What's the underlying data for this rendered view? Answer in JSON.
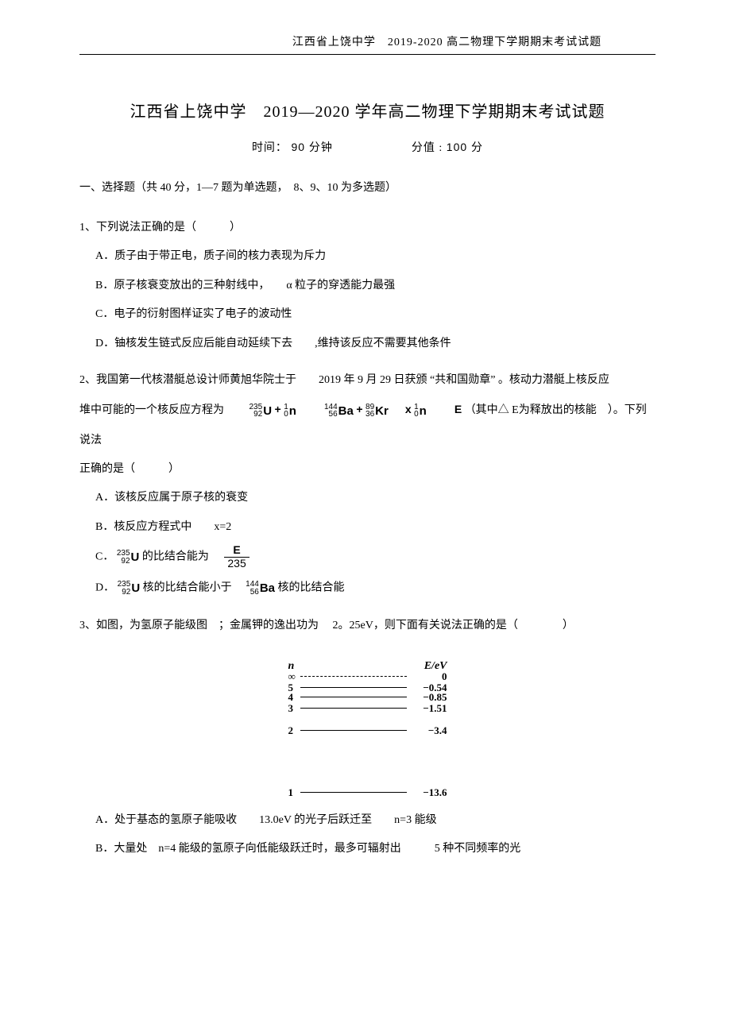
{
  "header": "江西省上饶中学　2019-2020 高二物理下学期期末考试试题",
  "title": "江西省上饶中学　2019—2020 学年高二物理下学期期末考试试题",
  "meta": {
    "time_label": "时间：",
    "time_value": "90 分钟",
    "score_label": "分值 :",
    "score_value": "100 分"
  },
  "section1": "一、选择题（共 40 分，1—7 题为单选题，　8、9、10 为多选题）",
  "q1": {
    "stem": "1、下列说法正确的是（　　　）",
    "A": "A．质子由于带正电，质子间的核力表现为斥力",
    "B": "B．原子核衰变放出的三种射线中，　　α 粒子的穿透能力最强",
    "C": "C．电子的衍射图样证实了电子的波动性",
    "D": "D．铀核发生链式反应后能自动延续下去　　,维持该反应不需要其他条件"
  },
  "q2": {
    "stem_p1": "2、我国第一代核潜艇总设计师黄旭华院士于　　2019 年 9 月 29 日获颁 “共和国勋章” 。核动力潜艇上核反应",
    "stem_p2a": "堆中可能的一个核反应方程为　　",
    "iso_U235_a": "235",
    "iso_U235_z": "92",
    "iso_U235_s": "U",
    "plus1": "+",
    "iso_n_a": "1",
    "iso_n_z": "0",
    "iso_n_s": "n",
    "iso_Ba_a": "144",
    "iso_Ba_z": "56",
    "iso_Ba_s": "Ba",
    "plus2": "+",
    "iso_Kr_a": "89",
    "iso_Kr_z": "36",
    "iso_Kr_s": "Kr",
    "xterm": "x",
    "Eterm": "E",
    "stem_p2b": "（其中△ E为释放出的核能　）。下列说法",
    "stem_p3": "正确的是（　　　）",
    "A": "A．该核反应属于原子核的衰变",
    "B": "B．核反应方程式中　　x=2",
    "C_pre": "C．",
    "C_post": " 的比结合能为　",
    "frac_num": "E",
    "frac_den": "235",
    "D_pre": "D．",
    "D_mid": " 核的比结合能小于　",
    "D_post": "核的比结合能"
  },
  "q3": {
    "stem": "3、如图，为氢原子能级图　；金属钾的逸出功为　 2。25eV，则下面有关说法正确的是（　　　　）",
    "levels": {
      "n_label": "n",
      "e_label": "E/eV",
      "inf_n": "∞",
      "inf_e": "0",
      "n5": "5",
      "e5": "−0.54",
      "n4": "4",
      "e4": "−0.85",
      "n3": "3",
      "e3": "−1.51",
      "n2": "2",
      "e2": "−3.4",
      "n1": "1",
      "e1": "−13.6"
    },
    "A": "A．处于基态的氢原子能吸收　　13.0eV 的光子后跃迁至　　n=3 能级",
    "B": "B．大量处　n=4 能级的氢原子向低能级跃迁时，最多可辐射出　　　5 种不同频率的光"
  }
}
